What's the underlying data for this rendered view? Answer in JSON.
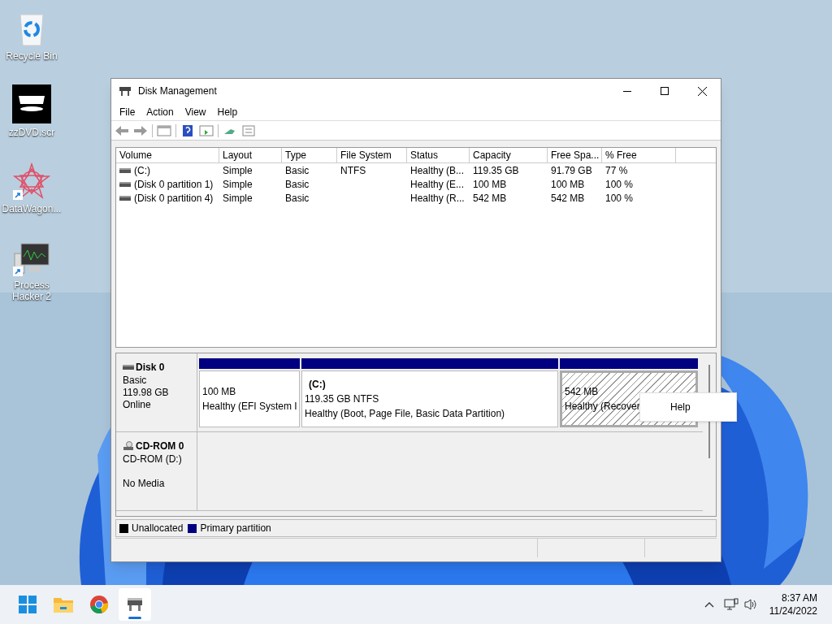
{
  "desktop_icons": [
    {
      "label": "Recycle Bin",
      "kind": "recycle",
      "shortcut": false
    },
    {
      "label": "zzDVD.scr",
      "kind": "dvd",
      "shortcut": false
    },
    {
      "label": "DataWagon...",
      "kind": "star",
      "shortcut": true
    },
    {
      "label": "Process Hacker 2",
      "kind": "monitor",
      "shortcut": true
    }
  ],
  "window": {
    "title": "Disk Management",
    "menu": [
      "File",
      "Action",
      "View",
      "Help"
    ]
  },
  "volume_table": {
    "columns": [
      "Volume",
      "Layout",
      "Type",
      "File System",
      "Status",
      "Capacity",
      "Free Spa...",
      "% Free"
    ],
    "rows": [
      {
        "cells": [
          "(C:)",
          "Simple",
          "Basic",
          "NTFS",
          "Healthy (B...",
          "119.35 GB",
          "91.79 GB",
          "77 %"
        ]
      },
      {
        "cells": [
          "(Disk 0 partition 1)",
          "Simple",
          "Basic",
          "",
          "Healthy (E...",
          "100 MB",
          "100 MB",
          "100 %"
        ]
      },
      {
        "cells": [
          "(Disk 0 partition 4)",
          "Simple",
          "Basic",
          "",
          "Healthy (R...",
          "542 MB",
          "542 MB",
          "100 %"
        ]
      }
    ]
  },
  "disks": [
    {
      "name": "Disk 0",
      "kind": "disk",
      "lines": [
        "Basic",
        "119.98 GB"
      ],
      "state": "Online",
      "partitions": [
        {
          "size": "100 MB",
          "status": "Healthy (EFI System I",
          "selected": false
        },
        {
          "label": "(C:)",
          "size": "119.35 GB NTFS",
          "status": "Healthy (Boot, Page File, Basic Data Partition)",
          "selected": false
        },
        {
          "size": "542 MB",
          "status": "Healthy (Recover",
          "selected": true
        }
      ]
    },
    {
      "name": "CD-ROM 0",
      "kind": "cdrom",
      "lines": [
        "CD-ROM (D:)"
      ],
      "state": "No Media"
    }
  ],
  "context_menu": {
    "items": [
      "Help"
    ]
  },
  "legend": [
    {
      "label": "Unallocated",
      "color": "#000000"
    },
    {
      "label": "Primary partition",
      "color": "#000080"
    }
  ],
  "taskbar": {
    "apps": [
      {
        "kind": "start",
        "selected": false
      },
      {
        "kind": "folder",
        "selected": false
      },
      {
        "kind": "chrome",
        "selected": false
      },
      {
        "kind": "disk",
        "selected": true
      }
    ],
    "time": "8:37 AM",
    "date": "11/24/2022"
  }
}
